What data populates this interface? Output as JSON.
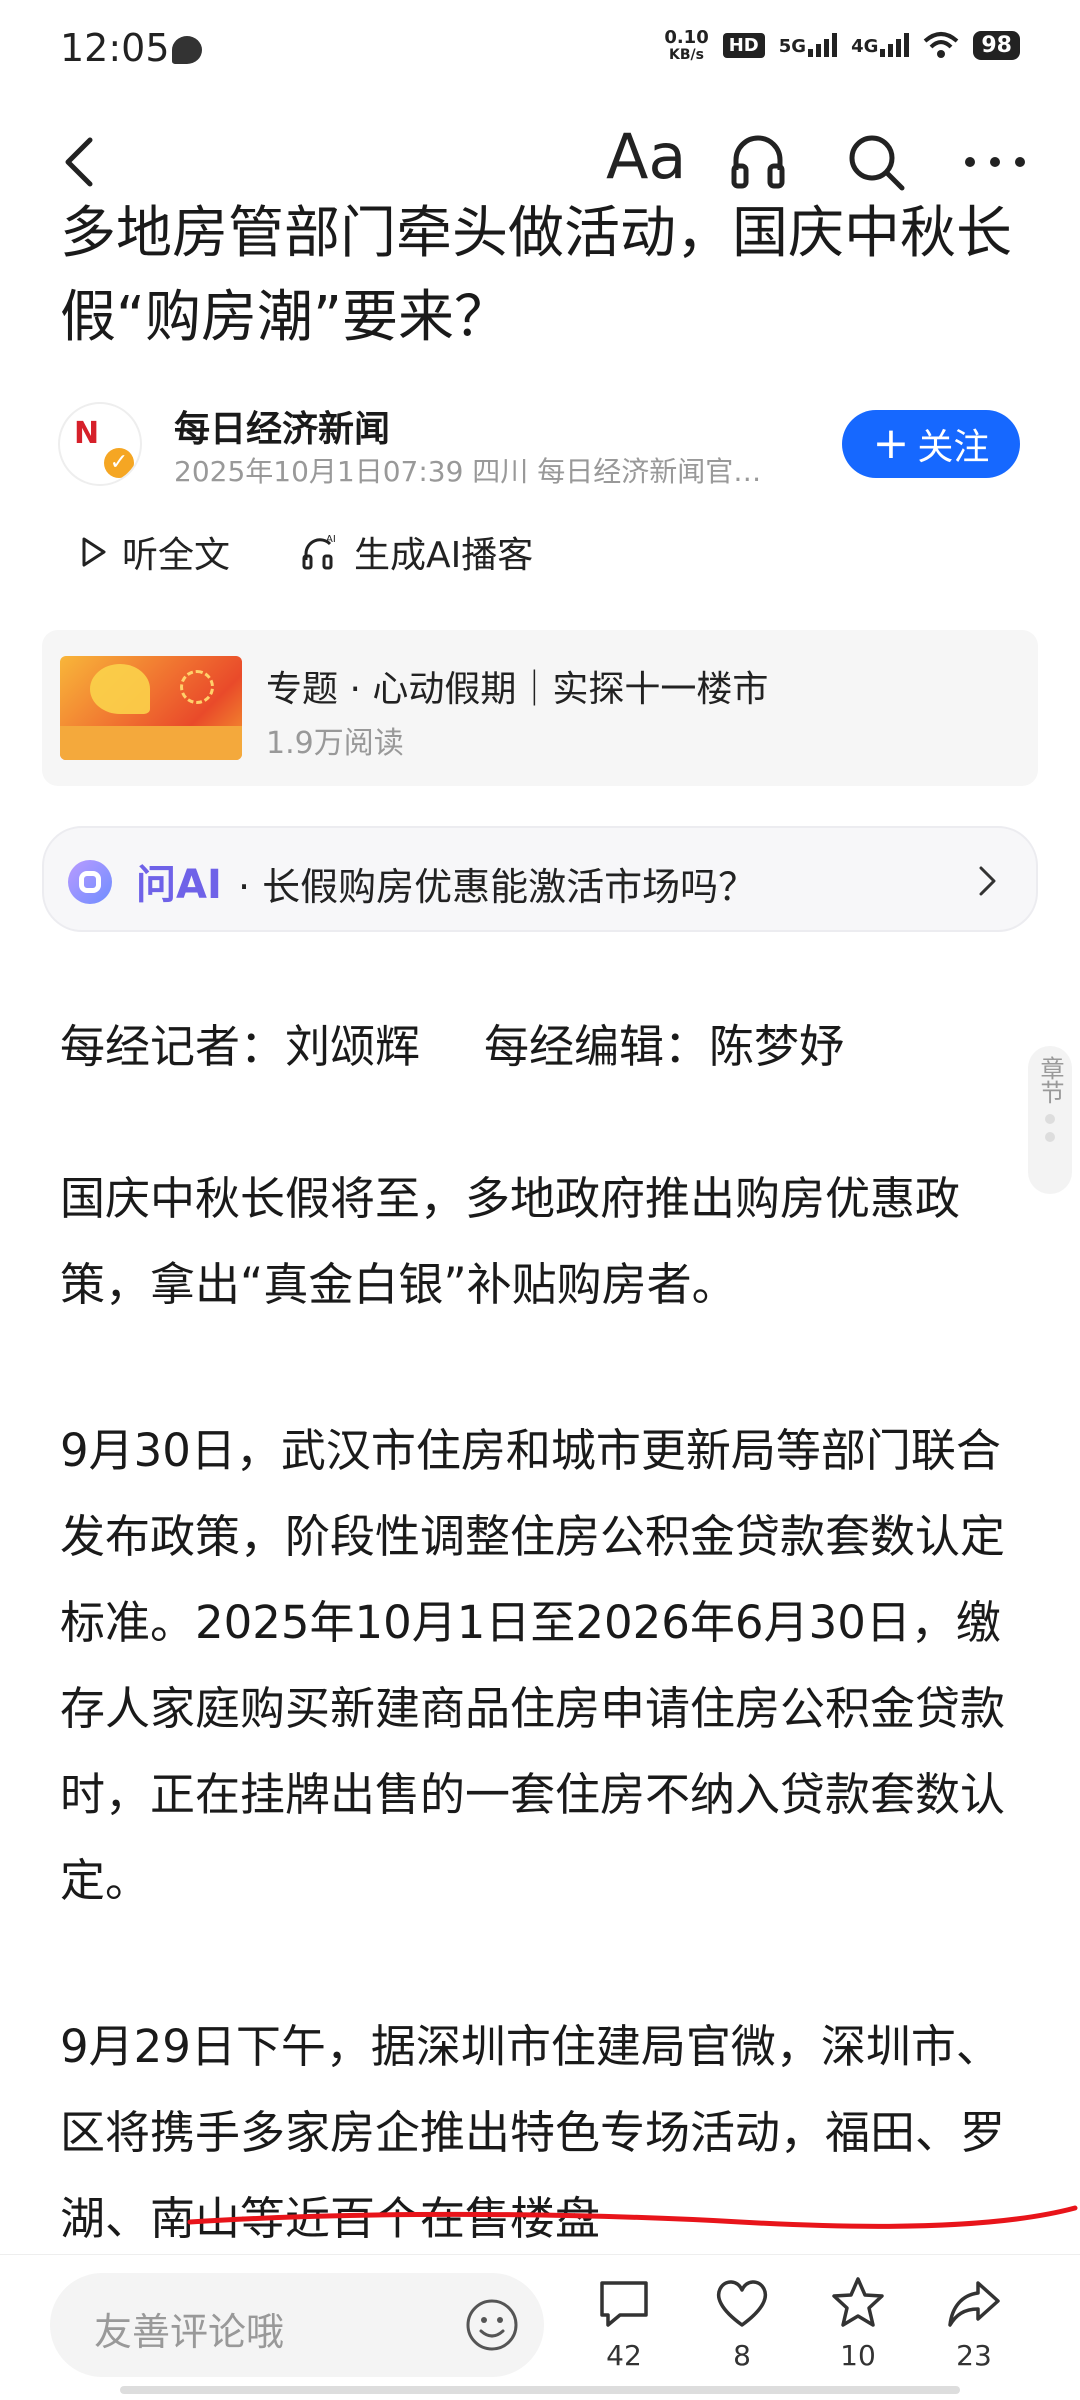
{
  "status_bar": {
    "time": "12:05",
    "net_speed_value": "0.10",
    "net_speed_unit": "KB/s",
    "hd": "HD",
    "net1": "5G",
    "net2": "4G",
    "battery": "98"
  },
  "nav": {
    "font_label": "Aa"
  },
  "article": {
    "title": "多地房管部门牵头做活动，国庆中秋长假“购房潮”要来？",
    "author_name": "每日经济新闻",
    "author_meta": "2025年10月1日07:39 四川 每日经济新闻官…",
    "avatar_text": "N",
    "follow_label": "关注",
    "listen_label": "听全文",
    "podcast_label": "生成AI播客",
    "topic": {
      "label": "专题 · 心动假期｜实探十一楼市",
      "reads": "1.9万阅读"
    },
    "ask_ai": {
      "brand": "问AI",
      "question": "· 长假购房优惠能激活市场吗？"
    },
    "byline_reporter": "每经记者：刘颂辉",
    "byline_editor": "每经编辑：陈梦妤",
    "paragraphs": [
      "国庆中秋长假将至，多地政府推出购房优惠政策，拿出“真金白银”补贴购房者。",
      "9月30日，武汉市住房和城市更新局等部门联合发布政策，阶段性调整住房公积金贷款套数认定标准。2025年10月1日至2026年6月30日，缴存人家庭购买新建商品住房申请住房公积金贷款时，正在挂牌出售的一套住房不纳入贷款套数认定。",
      "9月29日下午，据深圳市住建局官微，深圳市、区将携手多家房企推出特色专场活动，福田、罗湖、南山等近百个在售楼盘"
    ],
    "chapter_label": "章节"
  },
  "bottom_bar": {
    "comment_placeholder": "友善评论哦",
    "comments": "42",
    "likes": "8",
    "favorites": "10",
    "shares": "23"
  },
  "colors": {
    "accent": "#1668ff",
    "ai_purple": "#6f62e8",
    "annotation_red": "#e8141a"
  }
}
